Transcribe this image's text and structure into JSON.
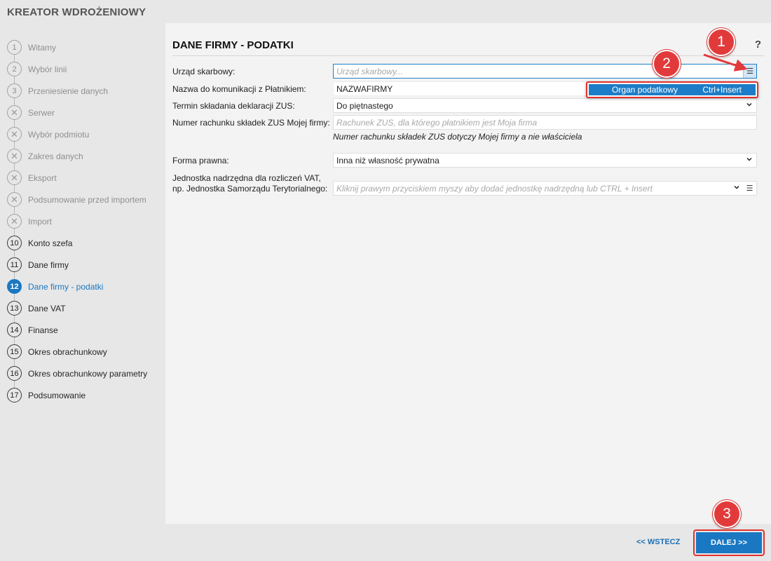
{
  "app": {
    "title": "KREATOR WDROŻENIOWY"
  },
  "steps": [
    {
      "num": "1",
      "label": "Witamy",
      "state": "done"
    },
    {
      "num": "2",
      "label": "Wybór linii",
      "state": "done"
    },
    {
      "num": "3",
      "label": "Przeniesienie danych",
      "state": "done"
    },
    {
      "num": "✕",
      "label": "Serwer",
      "state": "skipped"
    },
    {
      "num": "✕",
      "label": "Wybór podmiotu",
      "state": "skipped"
    },
    {
      "num": "✕",
      "label": "Zakres danych",
      "state": "skipped"
    },
    {
      "num": "✕",
      "label": "Eksport",
      "state": "skipped"
    },
    {
      "num": "✕",
      "label": "Podsumowanie przed importem",
      "state": "skipped"
    },
    {
      "num": "✕",
      "label": "Import",
      "state": "skipped"
    },
    {
      "num": "10",
      "label": "Konto szefa",
      "state": "todo"
    },
    {
      "num": "11",
      "label": "Dane firmy",
      "state": "todo"
    },
    {
      "num": "12",
      "label": "Dane firmy - podatki",
      "state": "active"
    },
    {
      "num": "13",
      "label": "Dane VAT",
      "state": "todo"
    },
    {
      "num": "14",
      "label": "Finanse",
      "state": "todo"
    },
    {
      "num": "15",
      "label": "Okres obrachunkowy",
      "state": "todo"
    },
    {
      "num": "16",
      "label": "Okres obrachunkowy parametry",
      "state": "todo"
    },
    {
      "num": "17",
      "label": "Podsumowanie",
      "state": "todo"
    }
  ],
  "page": {
    "title": "DANE FIRMY - PODATKI",
    "help": "?"
  },
  "form": {
    "tax_office": {
      "label": "Urząd skarbowy:",
      "placeholder": "Urząd skarbowy..."
    },
    "payer_name": {
      "label": "Nazwa do komunikacji z Płatnikiem:",
      "value": "NAZWAFIRMY"
    },
    "zus_deadline": {
      "label": "Termin składania deklaracji ZUS:",
      "value": "Do piętnastego"
    },
    "zus_account": {
      "label": "Numer rachunku składek ZUS Mojej firmy:",
      "placeholder": "Rachunek ZUS, dla którego płatnikiem jest Moja firma",
      "hint": "Numer rachunku składek ZUS dotyczy Mojej firmy a nie właściciela"
    },
    "legal_form": {
      "label": "Forma prawna:",
      "value": "Inna niż własność prywatna"
    },
    "vat_parent": {
      "label_line1": "Jednostka nadrzędna dla rozliczeń VAT,",
      "label_line2": "np. Jednostka Samorządu Terytorialnego:",
      "placeholder": "Kliknij prawym przyciskiem myszy aby dodać jednostkę nadrzędną lub CTRL + Insert"
    }
  },
  "context_menu": {
    "item_label": "Organ podatkowy",
    "item_shortcut": "Ctrl+Insert"
  },
  "callouts": [
    "1",
    "2",
    "3"
  ],
  "footer": {
    "back_label": "<< WSTECZ",
    "next_label": "DALEJ >>"
  },
  "colors": {
    "accent": "#1a78c2",
    "highlight": "#e0322f",
    "panel": "#f3f3f3",
    "background": "#e7e7e7"
  }
}
